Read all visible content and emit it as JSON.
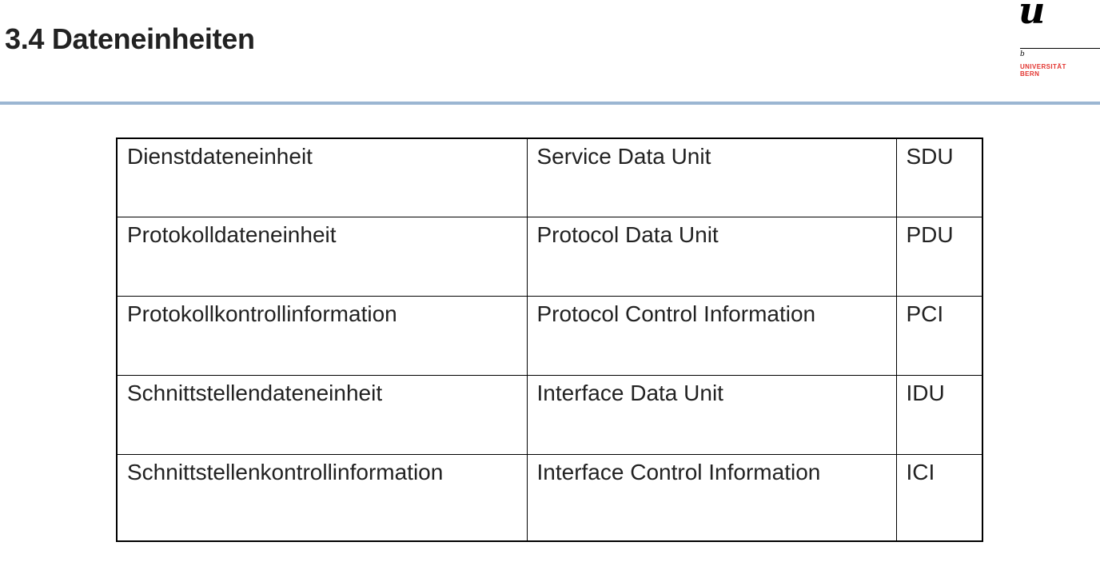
{
  "header": {
    "title": "3.4 Dateneinheiten"
  },
  "logo": {
    "glyph": "u",
    "superscript": "b",
    "name_line1": "UNIVERSITÄT",
    "name_line2": "BERN",
    "brand_color": "#e3342f"
  },
  "accent_rule_color": "#9bb6d2",
  "table": {
    "rows": [
      [
        "Dienstdateneinheit",
        "Service Data Unit",
        "SDU"
      ],
      [
        "Protokolldateneinheit",
        "Protocol Data Unit",
        "PDU"
      ],
      [
        "Protokollkontrollinformation",
        "Protocol Control Information",
        "PCI"
      ],
      [
        "Schnittstellendateneinheit",
        "Interface Data Unit",
        "IDU"
      ],
      [
        "Schnittstellenkontrollinformation",
        "Interface Control Information",
        "ICI"
      ]
    ]
  }
}
